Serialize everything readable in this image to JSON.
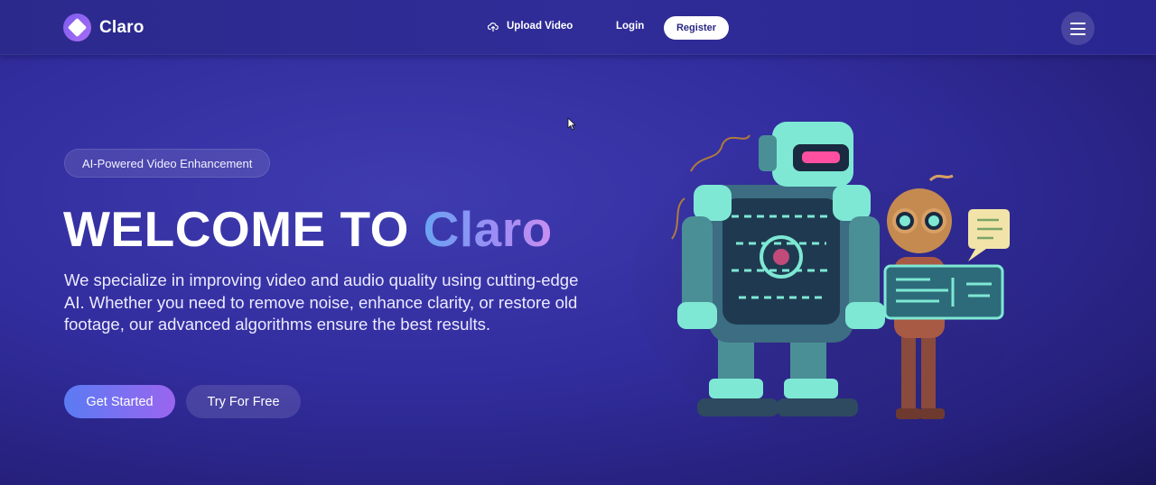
{
  "nav": {
    "brand_name": "Claro",
    "upload_label": "Upload Video",
    "login_label": "Login",
    "register_label": "Register",
    "icons": {
      "logo": "diamond-logo-icon",
      "upload": "cloud-upload-icon",
      "menu": "hamburger-menu-icon"
    }
  },
  "hero": {
    "badge": "AI-Powered Video Enhancement",
    "title_prefix": "WELCOME TO ",
    "title_accent": "Claro",
    "description": "We specialize in improving video and audio quality using cutting-edge AI. Whether you need to remove noise, enhance clarity, or restore old footage, our advanced algorithms ensure the best results.",
    "primary_button": "Get Started",
    "secondary_button": "Try For Free"
  },
  "colors": {
    "background": "#322d9e",
    "navbar": "#2b2a8c",
    "accent_gradient_start": "#6aa3f2",
    "accent_gradient_end": "#c98ff0",
    "button_gradient_start": "#5b7bf3",
    "button_gradient_end": "#9a65ef",
    "robot_teal": "#7ee8d4",
    "robot_eye": "#ff4fa0"
  }
}
